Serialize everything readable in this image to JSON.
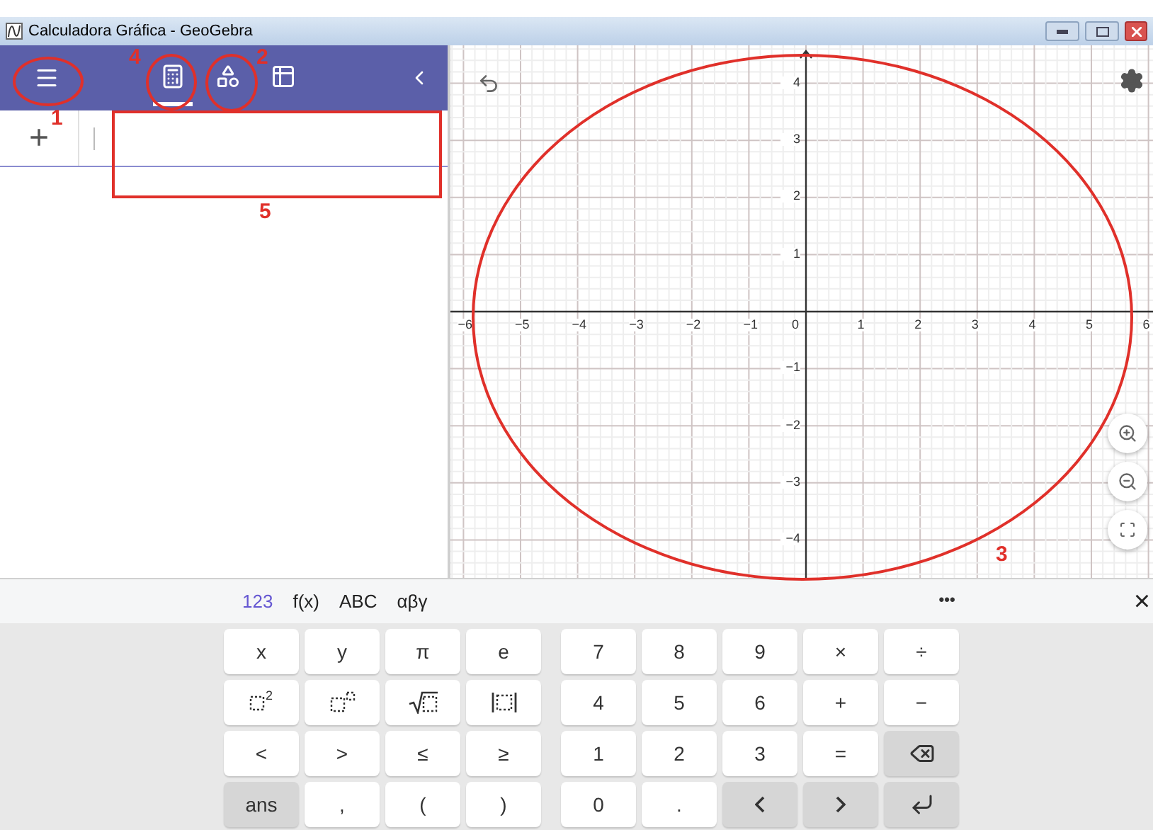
{
  "window": {
    "title": "Calculadora Gráfica - GeoGebra"
  },
  "app_header": {
    "views": [
      {
        "kind": "calculator",
        "selected": true
      },
      {
        "kind": "shapes",
        "selected": false
      },
      {
        "kind": "table",
        "selected": false
      }
    ]
  },
  "algebra": {
    "add": "+"
  },
  "graph": {
    "x_labels": [
      "−6",
      "−5",
      "−4",
      "−3",
      "−2",
      "−1",
      "0",
      "1",
      "2",
      "3",
      "4",
      "5",
      "6"
    ],
    "y_labels": [
      "4",
      "3",
      "2",
      "1",
      "−1",
      "−2",
      "−3",
      "−4"
    ]
  },
  "keyboard": {
    "tabs": [
      {
        "label": "123",
        "selected": true
      },
      {
        "label": "f(x)",
        "selected": false
      },
      {
        "label": "ABC",
        "selected": false
      },
      {
        "label": "αβγ",
        "selected": false
      }
    ],
    "more": "•••",
    "close": "×",
    "rows": [
      {
        "left": [
          {
            "kind": "text",
            "label": "x",
            "dark": false
          },
          {
            "kind": "text",
            "label": "y",
            "dark": false
          },
          {
            "kind": "text",
            "label": "π",
            "dark": false
          },
          {
            "kind": "text",
            "label": "e",
            "dark": false
          }
        ],
        "right": [
          {
            "kind": "text",
            "label": "7",
            "dark": false
          },
          {
            "kind": "text",
            "label": "8",
            "dark": false
          },
          {
            "kind": "text",
            "label": "9",
            "dark": false
          },
          {
            "kind": "text",
            "label": "×",
            "dark": false
          },
          {
            "kind": "text",
            "label": "÷",
            "dark": false
          }
        ]
      },
      {
        "left": [
          {
            "kind": "square",
            "label": "2",
            "dark": false
          },
          {
            "kind": "power",
            "dark": false
          },
          {
            "kind": "sqrt",
            "dark": false
          },
          {
            "kind": "abs",
            "dark": false
          }
        ],
        "right": [
          {
            "kind": "text",
            "label": "4",
            "dark": false
          },
          {
            "kind": "text",
            "label": "5",
            "dark": false
          },
          {
            "kind": "text",
            "label": "6",
            "dark": false
          },
          {
            "kind": "text",
            "label": "+",
            "dark": false
          },
          {
            "kind": "text",
            "label": "−",
            "dark": false
          }
        ]
      },
      {
        "left": [
          {
            "kind": "text",
            "label": "<",
            "dark": false
          },
          {
            "kind": "text",
            "label": ">",
            "dark": false
          },
          {
            "kind": "text",
            "label": "≤",
            "dark": false
          },
          {
            "kind": "text",
            "label": "≥",
            "dark": false
          }
        ],
        "right": [
          {
            "kind": "text",
            "label": "1",
            "dark": false
          },
          {
            "kind": "text",
            "label": "2",
            "dark": false
          },
          {
            "kind": "text",
            "label": "3",
            "dark": false
          },
          {
            "kind": "text",
            "label": "=",
            "dark": false
          },
          {
            "kind": "backspace",
            "dark": true
          }
        ]
      },
      {
        "left": [
          {
            "kind": "text",
            "label": "ans",
            "dark": true
          },
          {
            "kind": "text",
            "label": ",",
            "dark": false
          },
          {
            "kind": "text",
            "label": "(",
            "dark": false
          },
          {
            "kind": "text",
            "label": ")",
            "dark": false
          }
        ],
        "right": [
          {
            "kind": "text",
            "label": "0",
            "dark": false
          },
          {
            "kind": "text",
            "label": ".",
            "dark": false
          },
          {
            "kind": "left",
            "dark": true
          },
          {
            "kind": "right",
            "dark": true
          },
          {
            "kind": "enter",
            "dark": true
          }
        ]
      }
    ]
  },
  "annotations": [
    {
      "kind": "ellipse",
      "number": "1"
    },
    {
      "kind": "ellipse",
      "number": "4"
    },
    {
      "kind": "ellipse",
      "number": "2"
    },
    {
      "kind": "rectangle",
      "number": "5"
    },
    {
      "kind": "ellipse",
      "number": "3"
    }
  ]
}
